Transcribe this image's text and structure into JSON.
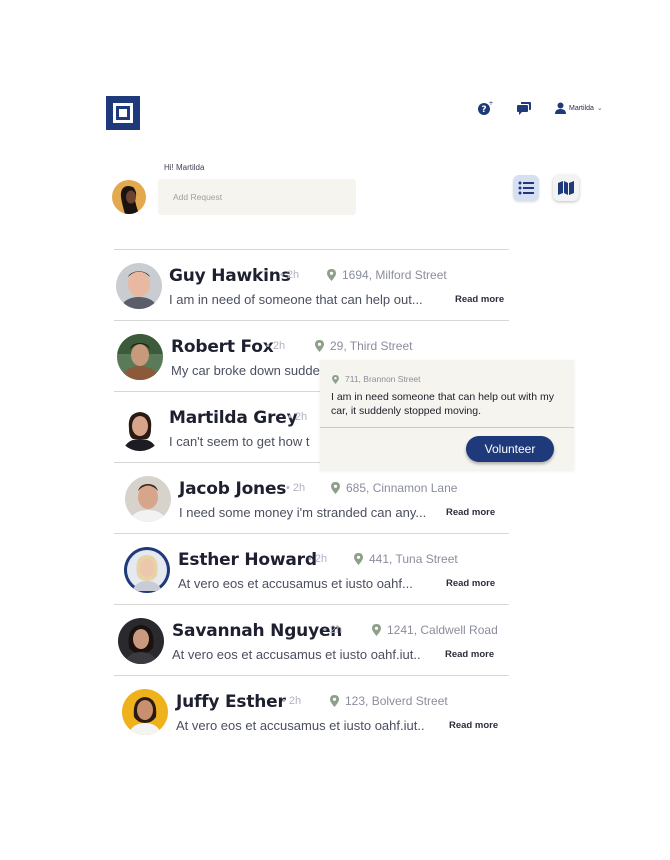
{
  "header": {
    "logo": "logo-icon",
    "help_icon": "help-icon",
    "chat_icon": "chat-icon",
    "user_icon": "user-icon",
    "user_name": "Martilda",
    "brand_color": "#1f3a7a"
  },
  "composer": {
    "greeting": "Hi! Martilda",
    "placeholder": "Add Request"
  },
  "view_toggle": {
    "list_icon": "list-icon",
    "map_icon": "map-icon"
  },
  "requests": [
    {
      "name": "Guy Hawkins",
      "time": "• 2h",
      "address": "1694, Milford Street",
      "message": "I am in need of someone that can help out...",
      "read_more": "Read more"
    },
    {
      "name": "Robert Fox",
      "time": "• 2h",
      "address": "29, Third Street",
      "message": "My car broke down sudde",
      "read_more": ""
    },
    {
      "name": "Martilda Grey",
      "time": "• 2h",
      "address": "",
      "message": "I can't seem to get how t",
      "read_more": ""
    },
    {
      "name": "Jacob Jones",
      "time": "• 2h",
      "address": "685, Cinnamon Lane",
      "message": "I need some money i'm stranded can any...",
      "read_more": "Read more"
    },
    {
      "name": "Esther Howard",
      "time": "• 2h",
      "address": "441, Tuna Street",
      "message": "At vero eos et accusamus et iusto oahf...",
      "read_more": "Read more"
    },
    {
      "name": "Savannah Nguyen",
      "time": "• 2h",
      "address": "1241, Caldwell Road",
      "message": "At vero eos et accusamus et iusto oahf.iut..",
      "read_more": "Read more"
    },
    {
      "name": "Juffy Esther",
      "time": "• 2h",
      "address": "123, Bolverd Street",
      "message": "At vero eos et accusamus et iusto oahf.iut..",
      "read_more": "Read more"
    }
  ],
  "popup": {
    "address": "711, Brannon Street",
    "message": "I am in need someone that can help out with my car, it suddenly stopped moving.",
    "button": "Volunteer"
  }
}
